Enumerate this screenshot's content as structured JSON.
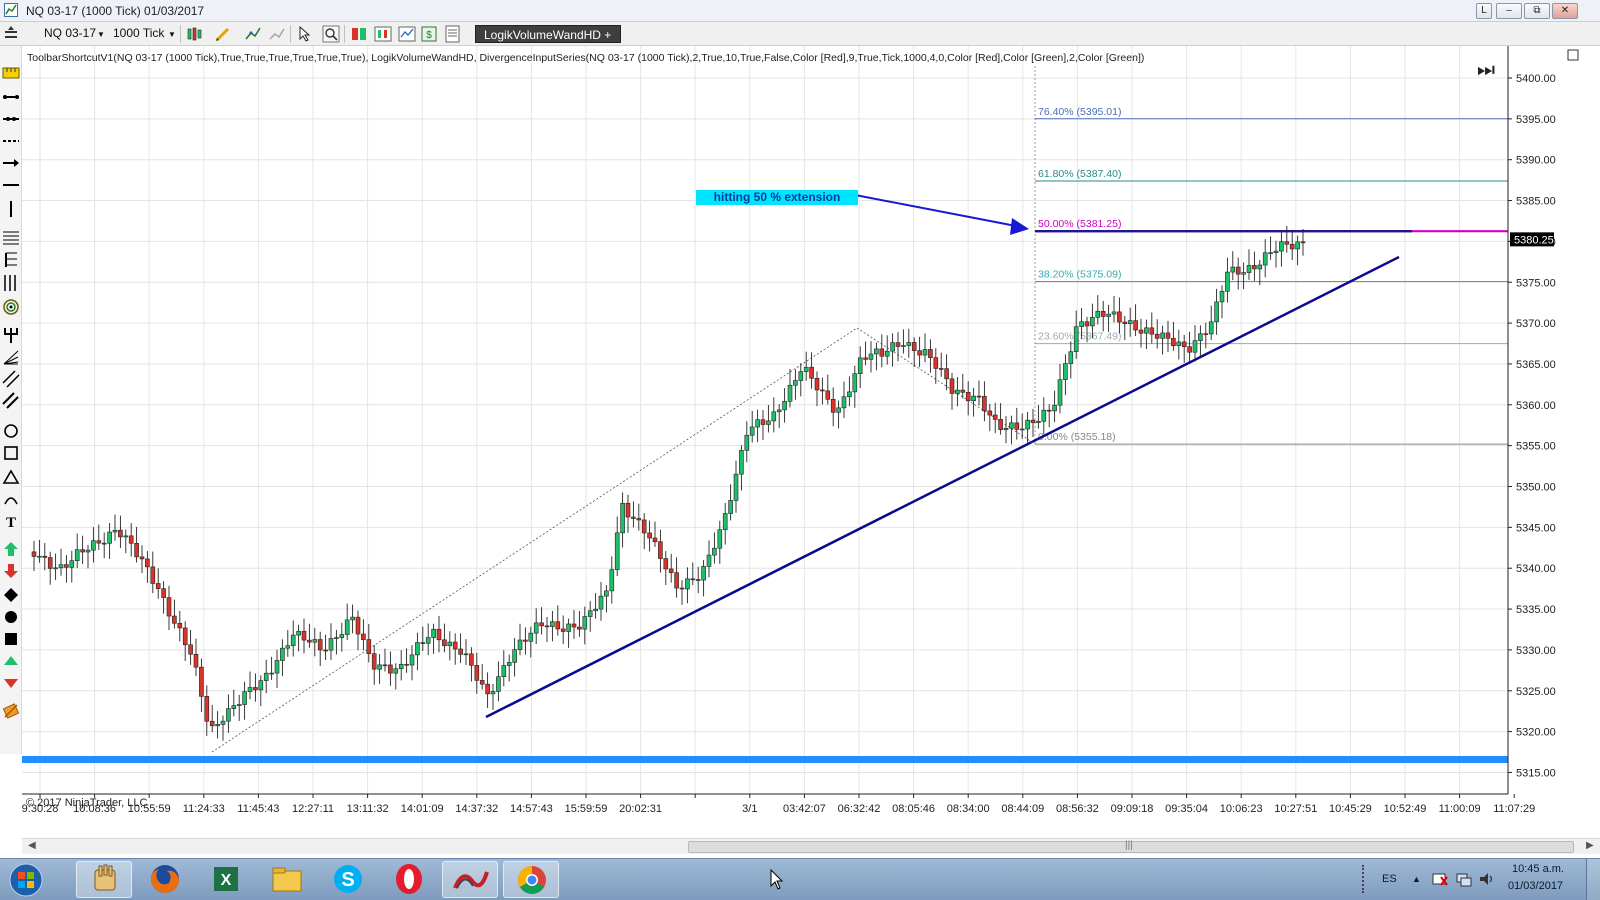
{
  "window": {
    "title": "NQ 03-17 (1000 Tick)  01/03/2017",
    "buttons": [
      "L",
      "–",
      "⧉",
      "✕"
    ]
  },
  "toolbar": {
    "instrument": "NQ 03-17",
    "interval": "1000 Tick",
    "indicator_button": "LogikVolumeWandHD +"
  },
  "chart": {
    "indicator_line": "ToolbarShortcutV1(NQ 03-17 (1000 Tick),True,True,True,True,True,True), LogikVolumeWandHD, DivergenceInputSeries(NQ 03-17 (1000 Tick),2,True,10,True,False,Color [Red],9,True,Tick,1000,4,0,Color [Red],Color [Green],2,Color [Green])",
    "copyright": "© 2017 NinjaTrader, LLC",
    "annotation": "hitting 50 % extension",
    "current_price": "5380.25",
    "y_ticks": [
      "5400.00",
      "5395.00",
      "5390.00",
      "5385.00",
      "5380.00",
      "5375.00",
      "5370.00",
      "5365.00",
      "5360.00",
      "5355.00",
      "5350.00",
      "5345.00",
      "5340.00",
      "5335.00",
      "5330.00",
      "5325.00",
      "5320.00",
      "5315.00"
    ],
    "x_ticks": [
      "9:30:28",
      "10:08:36",
      "10:55:59",
      "11:24:33",
      "11:45:43",
      "12:27:11",
      "13:11:32",
      "14:01:09",
      "14:37:32",
      "14:57:43",
      "15:59:59",
      "20:02:31",
      "",
      "3/1",
      "03:42:07",
      "06:32:42",
      "08:05:46",
      "08:34:00",
      "08:44:09",
      "08:56:32",
      "09:09:18",
      "09:35:04",
      "10:06:23",
      "10:27:51",
      "10:45:29",
      "10:52:49",
      "11:00:09",
      "11:07:29"
    ],
    "fib_levels": [
      {
        "label": "76.40% (5395.01)",
        "color": "#4a6fb5"
      },
      {
        "label": "61.80% (5387.40)",
        "color": "#2a8a8a"
      },
      {
        "label": "50.00% (5381.25)",
        "color": "#d000c0"
      },
      {
        "label": "38.20% (5375.09)",
        "color": "#3aa9b0"
      },
      {
        "label": "23.60% (5367.49)",
        "color": "#9aaab5"
      },
      {
        "label": "0.00% (5355.18)",
        "color": "#888888"
      }
    ],
    "colors": {
      "up": "#1fbf6a",
      "down": "#d9342b",
      "trend": "#0a0a8c",
      "support": "#1f8fff"
    }
  },
  "taskbar": {
    "lang": "ES",
    "time": "10:45 a.m.",
    "date": "01/03/2017",
    "apps": [
      "start-button",
      "hand-tool-icon",
      "firefox-icon",
      "excel-icon",
      "explorer-icon",
      "skype-icon",
      "opera-icon",
      "ninjatrader-icon",
      "chrome-icon"
    ]
  }
}
